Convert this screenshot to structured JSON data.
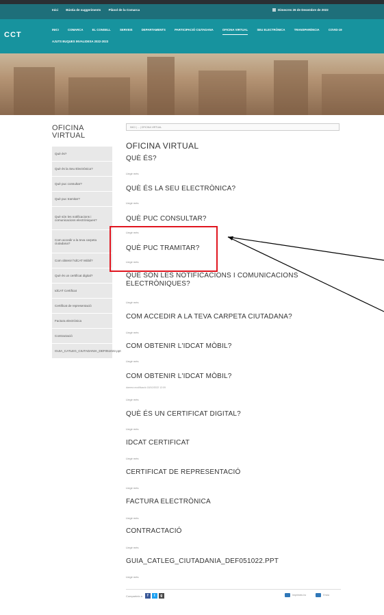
{
  "topbar": {
    "links": [
      "Inici",
      "Bústia de suggeriments",
      "Plànol de la Comarca"
    ],
    "date": "Dimecres 26 de Desembre de 2022"
  },
  "logo": {
    "text": "CCT"
  },
  "nav": {
    "row1": [
      "INICI",
      "COMARCA",
      "EL CONSELL",
      "SERVEIS",
      "DEPARTAMENTS",
      "PARTICIPACIÓ CIUTADANA",
      "OFICINA VIRTUAL",
      "SEU ELECTRÒNICA",
      "TRANSPARÈNCIA",
      "COVID-19"
    ],
    "row2": [
      "AJUTS BUQUES INVALIDESA 2022-2023"
    ],
    "active": "OFICINA VIRTUAL"
  },
  "sidebar": {
    "title": "OFICINA VIRTUAL",
    "items": [
      "Què és?",
      "Què és la Seu Electrònica?",
      "Què puc consultar?",
      "Què puc tramitar?",
      "Què són les notificacions i comunicacions electròniques?",
      "Com accedir a la teva carpeta ciutadana?",
      "Com obtenir l'IdCAT Mòbil?",
      "Què és un certificat digital?",
      "IdCAT Certificat",
      "Certificat de representació",
      "Factura electrònica",
      "Contractació",
      "GUIA_CATLEG_CIUTADANIA_DEF051022.ppt"
    ]
  },
  "breadcrumb": "INICI | ... | OFICINA VIRTUAL",
  "content": {
    "title": "OFICINA VIRTUAL",
    "more_label": "Llegir més",
    "sections": [
      "QUÈ ÉS?",
      "QUÈ ÉS LA SEU ELECTRÒNICA?",
      "QUÈ PUC CONSULTAR?",
      "QUÈ PUC TRAMITAR?",
      "QUÈ SÓN LES NOTIFICACIONS I COMUNICACIONS ELECTRÒNIQUES?",
      "COM ACCEDIR A LA TEVA CARPETA CIUTADANA?",
      "COM OBTENIR L'IDCAT MÒBIL?",
      "COM OBTENIR L'IDCAT MÒBIL?",
      "QUÈ ÉS UN CERTIFICAT DIGITAL?",
      "IDCAT CERTIFICAT",
      "CERTIFICAT DE REPRESENTACIÓ",
      "FACTURA ELECTRÒNICA",
      "CONTRACTACIÓ",
      "GUIA_CATLEG_CIUTADANIA_DEF051022.PPT"
    ],
    "modified_note": "darrera modificació 18/10/2022 12:09"
  },
  "footer": {
    "share_label": "Comparteix a",
    "print_label": "Imprimeix-ho",
    "email_label": "Envia",
    "colors": {
      "facebook": "#3b5998",
      "twitter": "#1da1f2",
      "gplus": "#4a4a4a"
    }
  }
}
